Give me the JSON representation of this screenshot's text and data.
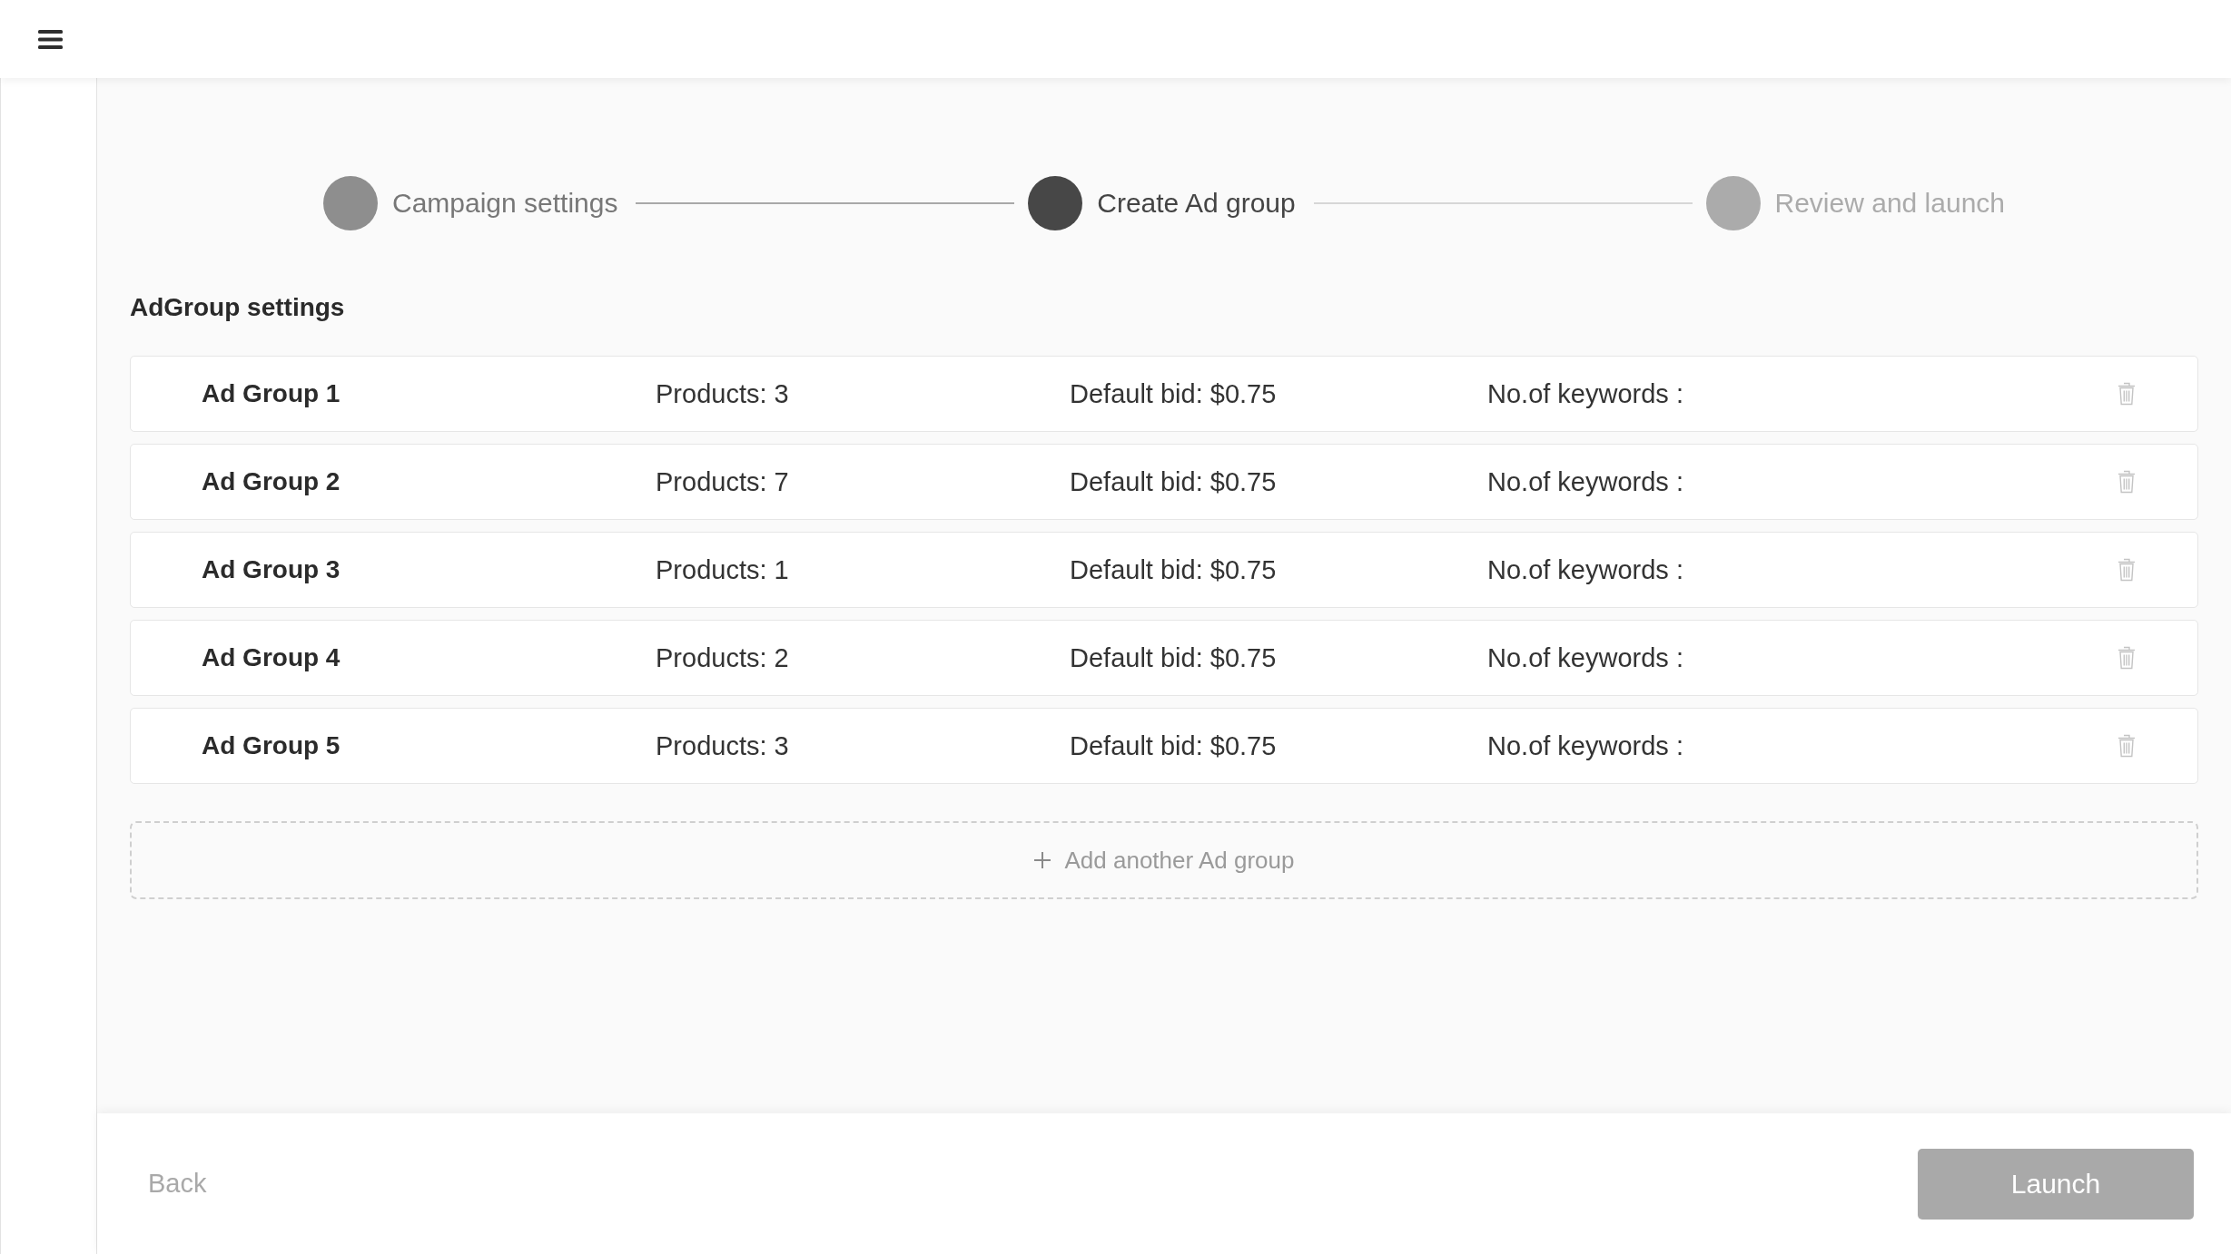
{
  "stepper": {
    "steps": [
      {
        "label": "Campaign settings",
        "completed": true,
        "selected": false
      },
      {
        "label": "Create Ad group",
        "completed": false,
        "selected": true
      },
      {
        "label": "Review and launch",
        "completed": false,
        "selected": false
      }
    ]
  },
  "section": {
    "title": "AdGroup settings"
  },
  "ad_groups": [
    {
      "name": "Ad Group 1",
      "products": "Products: 3",
      "default_bid": "Default bid: $0.75",
      "keywords": "No.of keywords :"
    },
    {
      "name": "Ad Group 2",
      "products": "Products: 7",
      "default_bid": "Default bid: $0.75",
      "keywords": "No.of keywords :"
    },
    {
      "name": "Ad Group 3",
      "products": "Products: 1",
      "default_bid": "Default bid: $0.75",
      "keywords": "No.of keywords :"
    },
    {
      "name": "Ad Group 4",
      "products": "Products: 2",
      "default_bid": "Default bid: $0.75",
      "keywords": "No.of keywords :"
    },
    {
      "name": "Ad Group 5",
      "products": "Products: 3",
      "default_bid": "Default bid: $0.75",
      "keywords": "No.of keywords :"
    }
  ],
  "add_button": {
    "label": "Add another Ad group"
  },
  "footer": {
    "back": {
      "label": "Back"
    },
    "launch": {
      "label": "Launch",
      "disabled": true
    }
  }
}
